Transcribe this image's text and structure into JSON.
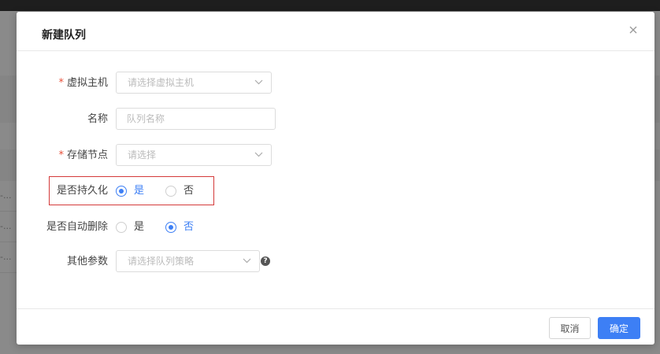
{
  "background": {
    "row_fragments": [
      "-...",
      "-...",
      "-..."
    ]
  },
  "modal": {
    "title": "新建队列",
    "close_icon": "close-icon",
    "fields": {
      "vm": {
        "label": "虚拟主机",
        "required": "*",
        "placeholder": "请选择虚拟主机"
      },
      "name": {
        "label": "名称",
        "placeholder": "队列名称",
        "value": ""
      },
      "storage": {
        "label": "存储节点",
        "required": "*",
        "placeholder": "请选择"
      },
      "durable": {
        "label": "是否持久化",
        "options": [
          "是",
          "否"
        ],
        "selected": "是"
      },
      "auto_delete": {
        "label": "是否自动删除",
        "options": [
          "是",
          "否"
        ],
        "selected": "否"
      },
      "params": {
        "label": "其他参数",
        "placeholder": "请选择队列策略",
        "help_icon": "question-circle-icon",
        "help_glyph": "?"
      }
    },
    "footer": {
      "cancel_label": "取消",
      "ok_label": "确定"
    },
    "colors": {
      "primary": "#3d7ff5",
      "required": "#e8503a",
      "highlight": "#d43a3a"
    }
  }
}
